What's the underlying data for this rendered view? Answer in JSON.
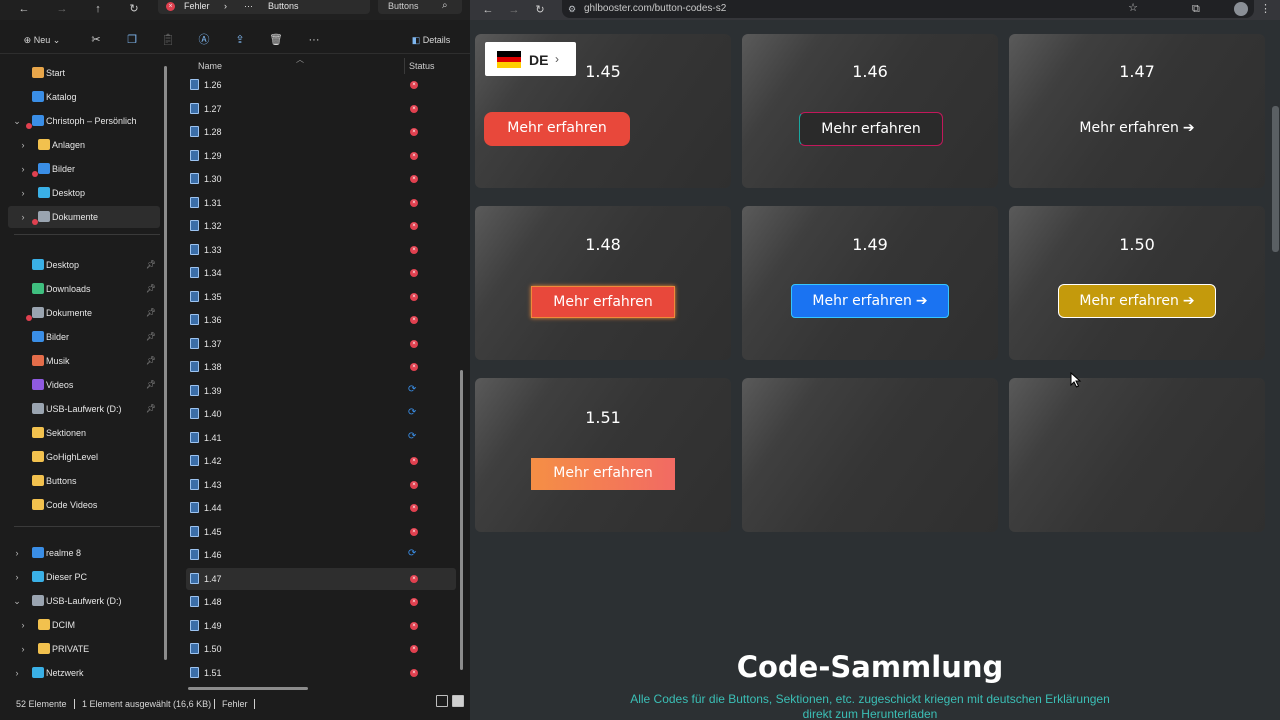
{
  "explorer": {
    "titlebar": {
      "path_folder": "Fehler",
      "path_sep": "›",
      "path_ellipsis": "···",
      "path_current": "Buttons",
      "search_text": "Buttons"
    },
    "toolbar": {
      "new_label": "Neu",
      "new_chevron": "⌄",
      "details_label": "Details",
      "more_label": "···"
    },
    "nav_items": [
      {
        "label": "Start",
        "icon": "home-icon",
        "color": "#e8a64a",
        "chevron": "",
        "indent": 0
      },
      {
        "label": "Katalog",
        "icon": "gallery-icon",
        "color": "#3a8ee6",
        "chevron": "",
        "indent": 0
      },
      {
        "label": "Christoph – Persönlich",
        "icon": "onedrive-icon",
        "color": "#3a8ee6",
        "chevron": "⌄",
        "indent": 0,
        "badge": true
      },
      {
        "label": "Anlagen",
        "icon": "folder-icon",
        "color": "#f2c14e",
        "chevron": "›",
        "indent": 1
      },
      {
        "label": "Bilder",
        "icon": "pictures-icon",
        "color": "#3a8ee6",
        "chevron": "›",
        "indent": 1,
        "badge": true
      },
      {
        "label": "Desktop",
        "icon": "desktop-icon",
        "color": "#3ab0e6",
        "chevron": "›",
        "indent": 1
      },
      {
        "label": "Dokumente",
        "icon": "documents-icon",
        "color": "#9aa4b0",
        "chevron": "›",
        "indent": 1,
        "badge": true,
        "selected": true
      }
    ],
    "quick_access": [
      {
        "label": "Desktop",
        "icon": "desktop-icon",
        "color": "#3ab0e6",
        "pinned": true
      },
      {
        "label": "Downloads",
        "icon": "download-icon",
        "color": "#3fbf7f",
        "pinned": true
      },
      {
        "label": "Dokumente",
        "icon": "documents-icon",
        "color": "#9aa4b0",
        "pinned": true,
        "badge": true
      },
      {
        "label": "Bilder",
        "icon": "pictures-icon",
        "color": "#3a8ee6",
        "pinned": true
      },
      {
        "label": "Musik",
        "icon": "music-icon",
        "color": "#e46d4a",
        "pinned": true
      },
      {
        "label": "Videos",
        "icon": "videos-icon",
        "color": "#8f5ae0",
        "pinned": true
      },
      {
        "label": "USB-Laufwerk (D:)",
        "icon": "usb-drive-icon",
        "color": "#9aa4b0",
        "pinned": true
      },
      {
        "label": "Sektionen",
        "icon": "folder-icon",
        "color": "#f2c14e",
        "pinned": false
      },
      {
        "label": "GoHighLevel",
        "icon": "folder-icon",
        "color": "#f2c14e",
        "pinned": false
      },
      {
        "label": "Buttons",
        "icon": "folder-icon",
        "color": "#f2c14e",
        "pinned": false
      },
      {
        "label": "Code Videos",
        "icon": "folder-icon",
        "color": "#f2c14e",
        "pinned": false
      }
    ],
    "devices": [
      {
        "label": "realme 8",
        "icon": "phone-icon",
        "color": "#3a8ee6",
        "chevron": "›",
        "indent": 0
      },
      {
        "label": "Dieser PC",
        "icon": "pc-icon",
        "color": "#3ab0e6",
        "chevron": "›",
        "indent": 0
      },
      {
        "label": "USB-Laufwerk (D:)",
        "icon": "usb-drive-icon",
        "color": "#9aa4b0",
        "chevron": "⌄",
        "indent": 0
      },
      {
        "label": "DCIM",
        "icon": "folder-icon",
        "color": "#f2c14e",
        "chevron": "›",
        "indent": 1
      },
      {
        "label": "PRIVATE",
        "icon": "folder-icon",
        "color": "#f2c14e",
        "chevron": "›",
        "indent": 1
      },
      {
        "label": "Netzwerk",
        "icon": "network-icon",
        "color": "#3ab0e6",
        "chevron": "›",
        "indent": 0
      }
    ],
    "columns": {
      "name": "Name",
      "status": "Status"
    },
    "files": [
      {
        "name": "1.26",
        "status": "error"
      },
      {
        "name": "1.27",
        "status": "error"
      },
      {
        "name": "1.28",
        "status": "error"
      },
      {
        "name": "1.29",
        "status": "error"
      },
      {
        "name": "1.30",
        "status": "error"
      },
      {
        "name": "1.31",
        "status": "error"
      },
      {
        "name": "1.32",
        "status": "error"
      },
      {
        "name": "1.33",
        "status": "error"
      },
      {
        "name": "1.34",
        "status": "error"
      },
      {
        "name": "1.35",
        "status": "error"
      },
      {
        "name": "1.36",
        "status": "error"
      },
      {
        "name": "1.37",
        "status": "error"
      },
      {
        "name": "1.38",
        "status": "error"
      },
      {
        "name": "1.39",
        "status": "sync"
      },
      {
        "name": "1.40",
        "status": "sync"
      },
      {
        "name": "1.41",
        "status": "sync"
      },
      {
        "name": "1.42",
        "status": "error"
      },
      {
        "name": "1.43",
        "status": "error"
      },
      {
        "name": "1.44",
        "status": "error"
      },
      {
        "name": "1.45",
        "status": "error"
      },
      {
        "name": "1.46",
        "status": "sync"
      },
      {
        "name": "1.47",
        "status": "error",
        "selected": true
      },
      {
        "name": "1.48",
        "status": "error"
      },
      {
        "name": "1.49",
        "status": "error"
      },
      {
        "name": "1.50",
        "status": "error"
      },
      {
        "name": "1.51",
        "status": "error"
      }
    ],
    "statusbar": {
      "count": "52 Elemente",
      "selection": "1 Element ausgewählt (16,6 KB)",
      "error": "Fehler"
    }
  },
  "browser": {
    "url": "ghlbooster.com/button-codes-s2",
    "language": {
      "code": "DE",
      "chevron": "›"
    },
    "cards": [
      {
        "number": "1.45",
        "button_label": "Mehr erfahren",
        "arrow": "",
        "style": "red-rounded"
      },
      {
        "number": "1.46",
        "button_label": "Mehr erfahren",
        "arrow": "",
        "style": "gradient-outline"
      },
      {
        "number": "1.47",
        "button_label": "Mehr erfahren",
        "arrow": "➔",
        "style": "plain-arrow"
      },
      {
        "number": "1.48",
        "button_label": "Mehr erfahren",
        "arrow": "",
        "style": "red-glow"
      },
      {
        "number": "1.49",
        "button_label": "Mehr erfahren",
        "arrow": "➔",
        "style": "blue-arrow"
      },
      {
        "number": "1.50",
        "button_label": "Mehr erfahren",
        "arrow": "➔",
        "style": "gold-arrow"
      },
      {
        "number": "1.51",
        "button_label": "Mehr erfahren",
        "arrow": "",
        "style": "orange-gradient"
      },
      {
        "number": "",
        "button_label": "",
        "arrow": "",
        "style": "empty"
      },
      {
        "number": "",
        "button_label": "",
        "arrow": "",
        "style": "empty"
      }
    ],
    "section_title": "Code-Sammlung",
    "section_subtitle": "Alle Codes für die Buttons, Sektionen, etc. zugeschickt kriegen mit deutschen Erklärungen direkt zum Herunterladen"
  }
}
